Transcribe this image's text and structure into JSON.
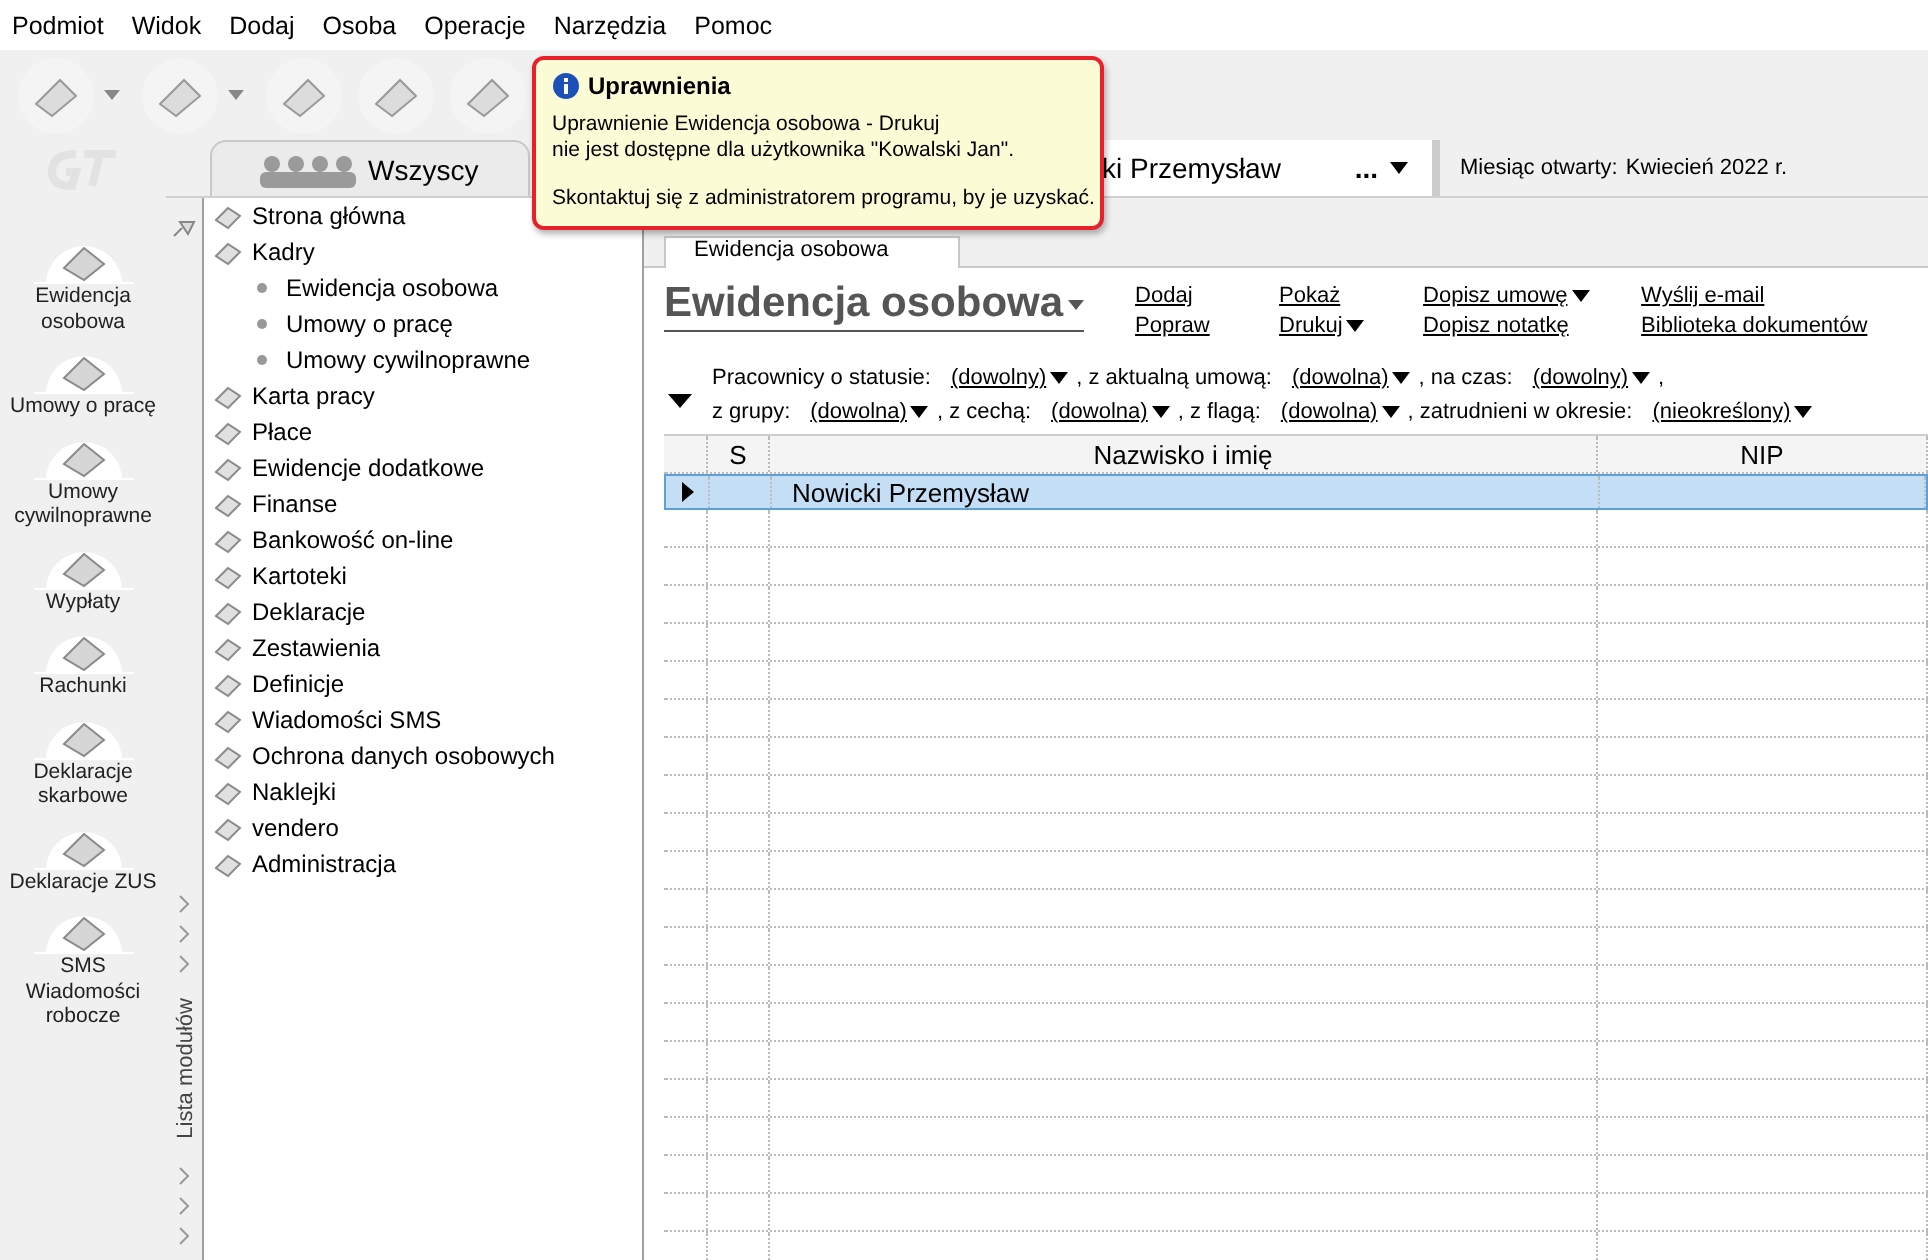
{
  "menu": [
    "Podmiot",
    "Widok",
    "Dodaj",
    "Osoba",
    "Operacje",
    "Narzędzia",
    "Pomoc"
  ],
  "side_nav": [
    {
      "label": "Ewidencja osobowa"
    },
    {
      "label": "Umowy o pracę"
    },
    {
      "label": "Umowy cywilnoprawne"
    },
    {
      "label": "Wypłaty"
    },
    {
      "label": "Rachunki"
    },
    {
      "label": "Deklaracje skarbowe"
    },
    {
      "label": "Deklaracje ZUS"
    },
    {
      "label": "SMS Wiadomości robocze"
    }
  ],
  "tab_bar": {
    "tab": "Wszyscy",
    "employee_field": "ki Przemysław",
    "field_ellipsis": "...",
    "month_label": "Miesiąc otwarty:",
    "month_value": "Kwiecień 2022 r."
  },
  "module_strip": {
    "label": "Lista modułów"
  },
  "tree": [
    {
      "label": "Strona główna"
    },
    {
      "label": "Kadry",
      "children": [
        {
          "label": "Ewidencja osobowa"
        },
        {
          "label": "Umowy o pracę"
        },
        {
          "label": "Umowy cywilnoprawne"
        }
      ]
    },
    {
      "label": "Karta pracy"
    },
    {
      "label": "Płace"
    },
    {
      "label": "Ewidencje dodatkowe"
    },
    {
      "label": "Finanse"
    },
    {
      "label": "Bankowość on-line"
    },
    {
      "label": "Kartoteki"
    },
    {
      "label": "Deklaracje"
    },
    {
      "label": "Zestawienia"
    },
    {
      "label": "Definicje"
    },
    {
      "label": "Wiadomości SMS"
    },
    {
      "label": "Ochrona danych osobowych"
    },
    {
      "label": "Naklejki"
    },
    {
      "label": "vendero"
    },
    {
      "label": "Administracja"
    }
  ],
  "document_tab": "Ewidencja osobowa",
  "title": "Ewidencja osobowa",
  "actions": [
    [
      {
        "label": "Dodaj",
        "dropdown": false
      },
      {
        "label": "Popraw",
        "dropdown": false
      }
    ],
    [
      {
        "label": "Pokaż",
        "dropdown": false
      },
      {
        "label": "Drukuj",
        "dropdown": true
      }
    ],
    [
      {
        "label": "Dopisz umowę",
        "dropdown": true
      },
      {
        "label": "Dopisz notatkę",
        "dropdown": false
      }
    ],
    [
      {
        "label": "Wyślij e-mail",
        "dropdown": false
      },
      {
        "label": "Biblioteka dokumentów",
        "dropdown": false
      }
    ]
  ],
  "filters": [
    [
      {
        "kind": "text",
        "text": "Pracownicy o statusie:"
      },
      {
        "kind": "dropdown",
        "text": "(dowolny)"
      },
      {
        "kind": "text",
        "text": ", z aktualną umową:"
      },
      {
        "kind": "dropdown",
        "text": "(dowolna)"
      },
      {
        "kind": "text",
        "text": ", na czas:"
      },
      {
        "kind": "dropdown",
        "text": "(dowolny)"
      },
      {
        "kind": "text",
        "text": ","
      }
    ],
    [
      {
        "kind": "text",
        "text": "z grupy:"
      },
      {
        "kind": "dropdown",
        "text": "(dowolna)"
      },
      {
        "kind": "text",
        "text": ", z cechą:"
      },
      {
        "kind": "dropdown",
        "text": "(dowolna)"
      },
      {
        "kind": "text",
        "text": ", z flagą:"
      },
      {
        "kind": "dropdown",
        "text": "(dowolna)"
      },
      {
        "kind": "text",
        "text": ", zatrudnieni w okresie:"
      },
      {
        "kind": "dropdown",
        "text": "(nieokreślony)"
      }
    ]
  ],
  "table": {
    "columns": [
      "S",
      "Nazwisko i imię",
      "NIP"
    ],
    "rows": [
      {
        "selected": true,
        "name": "Nowicki Przemysław"
      }
    ]
  },
  "tooltip": {
    "title": "Uprawnienia",
    "message": "Uprawnienie Ewidencja osobowa - Drukuj\nnie jest dostępne dla użytkownika \"Kowalski Jan\".",
    "note": "Skontaktuj się z administratorem programu, by je uzyskać."
  }
}
